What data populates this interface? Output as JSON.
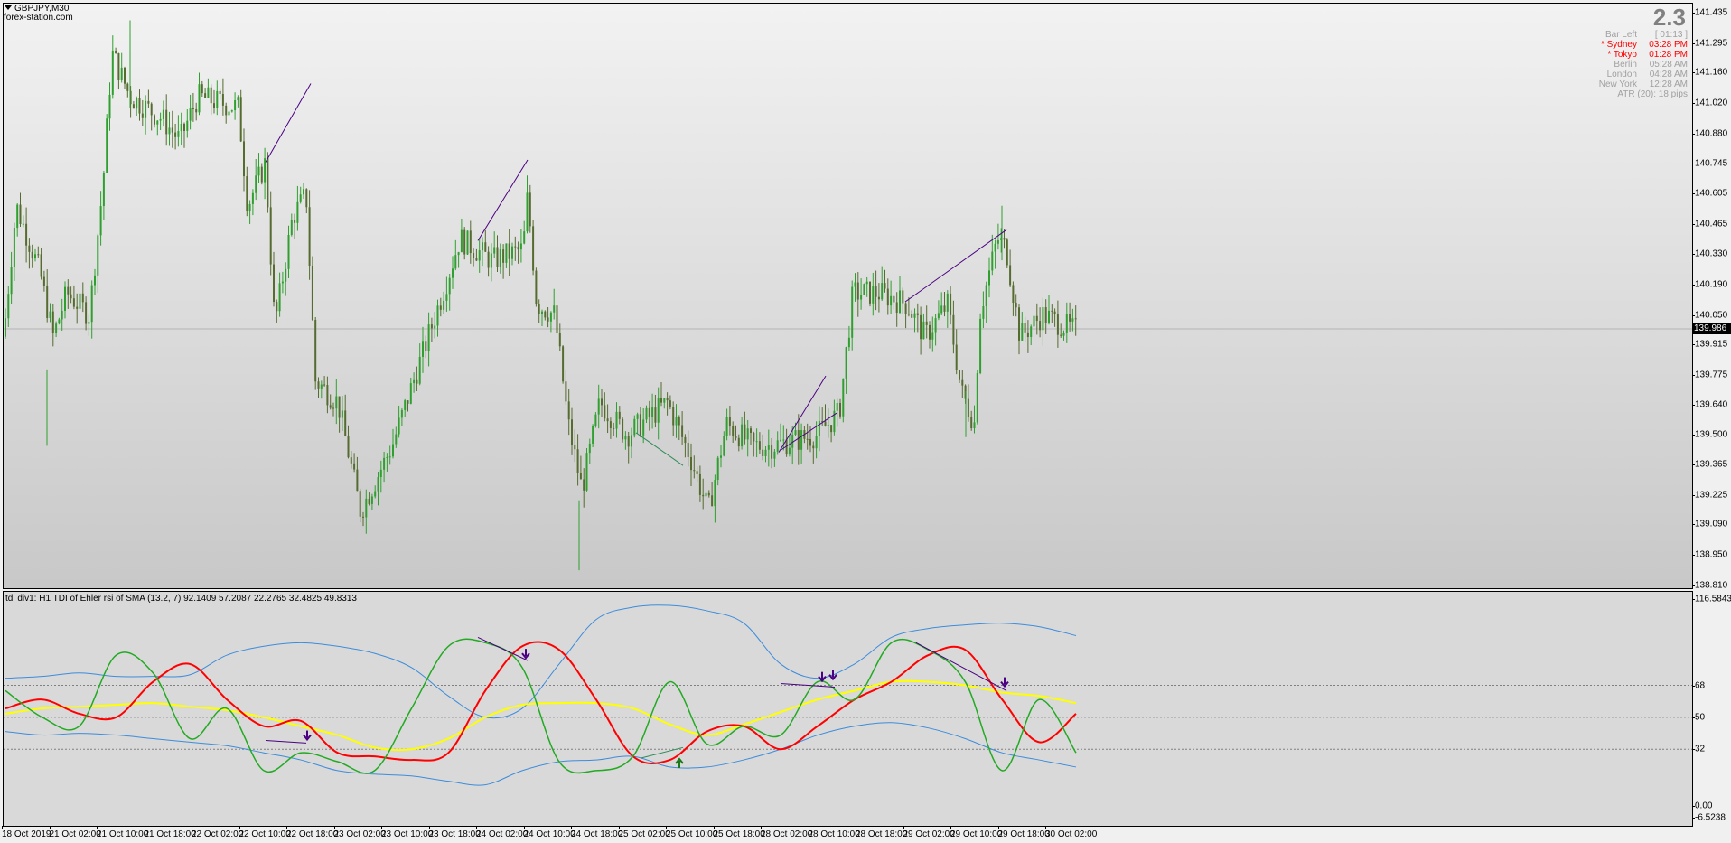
{
  "window": {
    "symbol": "GBPJPY,M30",
    "site": "forex-station.com",
    "current_price": "139.986"
  },
  "info_panel": {
    "big_value": "2.3",
    "bar_left_label": "Bar Left",
    "bar_left_value": "[ 01:13 ]",
    "sessions": [
      {
        "city": "* Sydney",
        "time": "03:28 PM",
        "color": "#ff0000"
      },
      {
        "city": "* Tokyo",
        "time": "01:28 PM",
        "color": "#ff0000"
      },
      {
        "city": "Berlin",
        "time": "05:28 AM",
        "color": "#a0a0a0"
      },
      {
        "city": "London",
        "time": "04:28 AM",
        "color": "#a0a0a0"
      },
      {
        "city": "New York",
        "time": "12:28 AM",
        "color": "#a0a0a0"
      }
    ],
    "atr": "ATR (20): 18 pips",
    "muted_color": "#a0a0a0"
  },
  "indicator_title": "tdi div1: H1  TDI of Ehler rsi of SMA (13.2, 7) 92.1409 57.2087 22.2765 32.4825 49.8313",
  "time_labels": [
    "18 Oct 2019",
    "21 Oct 02:00",
    "21 Oct 10:00",
    "21 Oct 18:00",
    "22 Oct 02:00",
    "22 Oct 10:00",
    "22 Oct 18:00",
    "23 Oct 02:00",
    "23 Oct 10:00",
    "23 Oct 18:00",
    "24 Oct 02:00",
    "24 Oct 10:00",
    "24 Oct 18:00",
    "25 Oct 02:00",
    "25 Oct 10:00",
    "25 Oct 18:00",
    "28 Oct 02:00",
    "28 Oct 10:00",
    "28 Oct 18:00",
    "29 Oct 02:00",
    "29 Oct 10:00",
    "29 Oct 18:00",
    "30 Oct 02:00"
  ],
  "chart_data": [
    {
      "type": "candlestick",
      "title": "GBPJPY,M30",
      "price_axis_ticks": [
        "141.435",
        "141.295",
        "141.160",
        "141.020",
        "140.880",
        "140.745",
        "140.605",
        "140.465",
        "140.330",
        "140.190",
        "140.050",
        "139.915",
        "139.775",
        "139.640",
        "139.500",
        "139.365",
        "139.225",
        "139.090",
        "138.950",
        "138.810"
      ],
      "ylim": [
        138.81,
        141.44
      ],
      "current_price": 139.986,
      "bull_color": "#2fa02f",
      "bear_color": "#556b2f",
      "trend_lines": [
        {
          "from": [
            0,
            140.75
          ],
          "to": [
            0,
            141.11
          ],
          "color": "#4b0082"
        },
        {
          "from": [
            0,
            140.39
          ],
          "to": [
            0,
            140.76
          ],
          "color": "#4b0082"
        },
        {
          "from": [
            0,
            139.51
          ],
          "to": [
            0,
            139.36
          ],
          "color": "#2e8b57"
        },
        {
          "from": [
            0,
            139.42
          ],
          "to": [
            0,
            139.77
          ],
          "color": "#4b0082"
        },
        {
          "from": [
            0,
            139.43
          ],
          "to": [
            0,
            139.6
          ],
          "color": "#4b0082"
        },
        {
          "from": [
            0,
            140.11
          ],
          "to": [
            0,
            140.44
          ],
          "color": "#4b0082"
        }
      ]
    },
    {
      "type": "line",
      "title": "tdi div1: H1  TDI of Ehler rsi of SMA (13.2, 7)",
      "axis_ticks": [
        "116.5843",
        "68",
        "50",
        "32",
        "0.00",
        "-6.5238"
      ],
      "ylim": [
        -6.5238,
        116.5843
      ],
      "levels": [
        68,
        50,
        32
      ],
      "series": [
        {
          "key": "upper_band",
          "color": "#3c8cdc",
          "values": [
            72,
            73,
            75,
            73,
            73,
            74,
            85,
            90,
            92,
            90,
            86,
            78,
            62,
            50,
            55,
            80,
            105,
            112,
            113,
            110,
            103,
            80,
            72,
            80,
            95,
            100,
            102,
            103,
            101,
            96
          ]
        },
        {
          "key": "lower_band",
          "color": "#3c8cdc",
          "values": [
            42,
            40,
            41,
            40,
            38,
            36,
            34,
            30,
            26,
            20,
            18,
            17,
            14,
            12,
            20,
            25,
            26,
            28,
            22,
            22,
            26,
            32,
            40,
            45,
            47,
            44,
            38,
            30,
            26,
            22
          ]
        },
        {
          "key": "yellow_line",
          "color": "#ffff00",
          "values": [
            52,
            55,
            56,
            57,
            58,
            56,
            54,
            50,
            45,
            40,
            33,
            32,
            38,
            50,
            57,
            58,
            58,
            55,
            46,
            40,
            46,
            53,
            60,
            65,
            70,
            70,
            68,
            64,
            62,
            58
          ]
        },
        {
          "key": "red_line",
          "color": "#ff0000",
          "values": [
            55,
            60,
            52,
            50,
            70,
            80,
            60,
            45,
            48,
            30,
            28,
            26,
            30,
            65,
            90,
            88,
            60,
            28,
            26,
            42,
            45,
            32,
            45,
            60,
            70,
            85,
            88,
            60,
            36,
            52
          ]
        },
        {
          "key": "green_line",
          "color": "#22aa22",
          "values": [
            65,
            50,
            45,
            85,
            75,
            38,
            55,
            20,
            30,
            25,
            20,
            55,
            90,
            92,
            78,
            25,
            20,
            28,
            70,
            35,
            45,
            40,
            70,
            60,
            92,
            88,
            70,
            20,
            60,
            30
          ]
        }
      ],
      "trend_lines": [
        {
          "from": [
            0,
            37.0
          ],
          "to": [
            0,
            35.5
          ],
          "color": "#4b0082"
        },
        {
          "from": [
            0,
            95.0
          ],
          "to": [
            0,
            82.0
          ],
          "color": "#4b0082"
        },
        {
          "from": [
            0,
            27.0
          ],
          "to": [
            0,
            33.0
          ],
          "color": "#2e8b57"
        },
        {
          "from": [
            0,
            69.0
          ],
          "to": [
            0,
            67.0
          ],
          "color": "#4b0082"
        },
        {
          "from": [
            0,
            92.0
          ],
          "to": [
            0,
            65.0
          ],
          "color": "#4b0082"
        }
      ],
      "arrows": [
        {
          "dir": "down",
          "value": 40.0
        },
        {
          "dir": "down",
          "value": 86.0
        },
        {
          "dir": "up",
          "value": 24.0
        },
        {
          "dir": "down",
          "value": 73.0
        },
        {
          "dir": "down",
          "value": 74.0
        },
        {
          "dir": "down",
          "value": 70.0
        }
      ],
      "arrow_down_color": "#4b0082",
      "arrow_up_color": "#1a7a1a"
    }
  ]
}
